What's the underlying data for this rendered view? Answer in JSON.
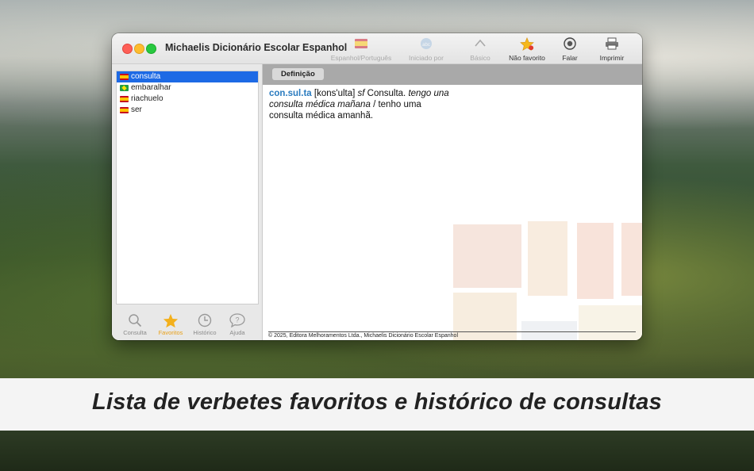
{
  "window": {
    "title": "Michaelis Dicionário Escolar Espanhol"
  },
  "toolbar": [
    {
      "label": "Espanhol/Português",
      "icon": "flag-icon",
      "enabled": false
    },
    {
      "label": "Iniciado por",
      "icon": "abc-icon",
      "enabled": false
    },
    {
      "label": "Básico",
      "icon": "chevron-up-icon",
      "enabled": false
    },
    {
      "label": "Não favorito",
      "icon": "star-icon",
      "enabled": true
    },
    {
      "label": "Falar",
      "icon": "speaker-icon",
      "enabled": true
    },
    {
      "label": "Imprimir",
      "icon": "printer-icon",
      "enabled": true
    }
  ],
  "sidebar": {
    "items": [
      {
        "label": "consulta",
        "flag": "es",
        "selected": true
      },
      {
        "label": "embaralhar",
        "flag": "br",
        "selected": false
      },
      {
        "label": "riachuelo",
        "flag": "es",
        "selected": false
      },
      {
        "label": "ser",
        "flag": "es",
        "selected": false
      }
    ],
    "tabs": [
      {
        "label": "Consulta",
        "icon": "search-icon",
        "active": false
      },
      {
        "label": "Favoritos",
        "icon": "star-icon",
        "active": true
      },
      {
        "label": "Histórico",
        "icon": "clock-icon",
        "active": false
      },
      {
        "label": "Ajuda",
        "icon": "help-icon",
        "active": false
      }
    ]
  },
  "main": {
    "tab_label": "Definição",
    "entry": {
      "headword": "con.sul.ta",
      "pronunciation": "[kons'ulta]",
      "class": "sf",
      "definition": "Consulta.",
      "example_es": "tengo una consulta médica mañana",
      "separator": "/",
      "example_pt": "tenho uma consulta médica amanhã."
    },
    "footer": "© 2025, Editora Melhoramentos Ltda., Michaelis Dicionário Escolar Espanhol"
  },
  "banner": {
    "text": "Lista de verbetes favoritos e histórico de consultas"
  },
  "colors": {
    "accent": "#1d6ae5",
    "headword": "#2a7bbf",
    "active_tab": "#f3b01c"
  }
}
